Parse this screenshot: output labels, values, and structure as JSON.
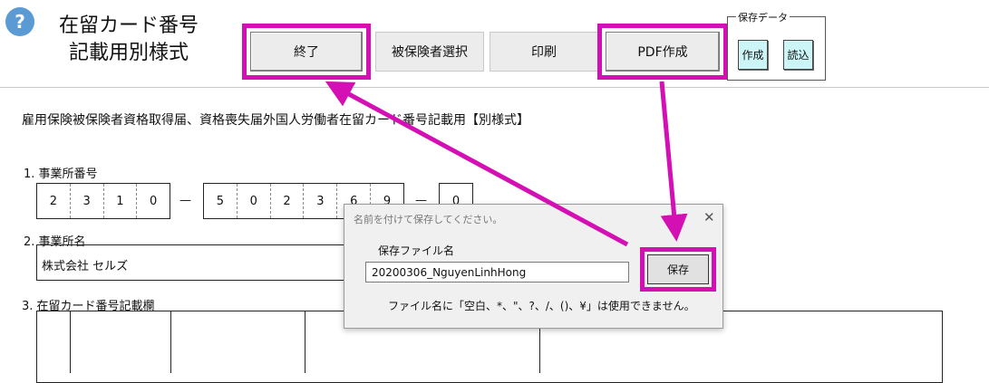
{
  "header": {
    "help_icon": "?",
    "title_line1": "在留カード番号",
    "title_line2": "記載用別様式",
    "buttons": {
      "exit": "終了",
      "select_insured": "被保険者選択",
      "print": "印刷",
      "create_pdf": "PDF作成"
    },
    "saved_data": {
      "label": "保存データ",
      "create": "作成",
      "load": "読込"
    }
  },
  "form": {
    "heading": "雇用保険被保険者資格取得届、資格喪失届外国人労働者在留カード番号記載用【別様式】",
    "office_number": {
      "label": "1. 事業所番号",
      "group1": [
        "2",
        "3",
        "1",
        "0"
      ],
      "dash1": "—",
      "group2": [
        "5",
        "0",
        "2",
        "3",
        "6",
        "9"
      ],
      "dash2": "—",
      "group3": [
        "0"
      ]
    },
    "office_name": {
      "label": "2. 事業所名",
      "value": "株式会社 セルズ"
    },
    "residence_card": {
      "label": "3. 在留カード番号記載欄"
    }
  },
  "dialog": {
    "title": "名前を付けて保存してください。",
    "close": "✕",
    "field_label": "保存ファイル名",
    "filename": "20200306_NguyenLinhHong",
    "save": "保存",
    "note": "ファイル名に「空白、*、\"、?、/、()、¥」は使用できません。"
  },
  "colors": {
    "highlight": "#d40fb3",
    "help_icon": "#5b9bd5",
    "small_button_bg": "#ccf5f7"
  }
}
